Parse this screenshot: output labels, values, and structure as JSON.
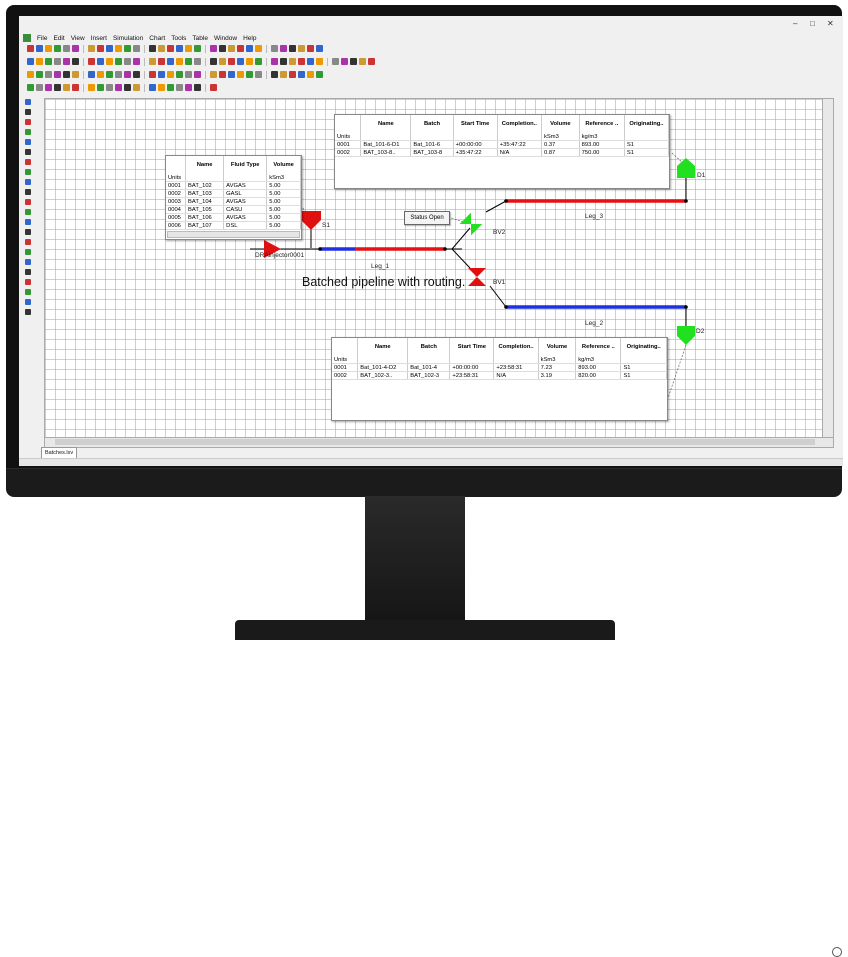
{
  "window": {
    "minimize_glyph": "–",
    "maximize_glyph": "□",
    "close_glyph": "✕"
  },
  "menu": [
    "File",
    "Edit",
    "View",
    "Insert",
    "Simulation",
    "Chart",
    "Tools",
    "Table",
    "Window",
    "Help"
  ],
  "tab": {
    "label": "Batches.lsv"
  },
  "caption": "Batched pipeline with routing.",
  "status_box": "Status Open",
  "labels": {
    "injector": "DRAinjector0001",
    "s1": "S1",
    "leg1": "Leg_1",
    "leg2": "Leg_2",
    "leg3": "Leg_3",
    "bv1": "BV1",
    "bv2": "BV2",
    "d1": "D1",
    "d2": "D2"
  },
  "colors": {
    "grid": "#78c878",
    "pipe_red": "#e81010",
    "pipe_blue": "#2030e0",
    "valve_red": "#e01010",
    "valve_green": "#20e020"
  },
  "batch_table": {
    "headers": [
      "",
      "Name",
      "Fluid Type",
      "Volume"
    ],
    "units": [
      "Units",
      "",
      "",
      "kSm3"
    ],
    "rows": [
      [
        "0001",
        "BAT_102",
        "AVGAS",
        "5.00"
      ],
      [
        "0002",
        "BAT_103",
        "GASL",
        "5.00"
      ],
      [
        "0003",
        "BAT_104",
        "AVGAS",
        "5.00"
      ],
      [
        "0004",
        "BAT_105",
        "CASU",
        "5.00"
      ],
      [
        "0005",
        "BAT_106",
        "AVGAS",
        "5.00"
      ],
      [
        "0006",
        "BAT_107",
        "DSL",
        "5.00"
      ]
    ]
  },
  "d1_table": {
    "headers": [
      "",
      "Name",
      "Batch",
      "Start Time",
      "Completion..",
      "Volume",
      "Reference ..",
      "Originating.."
    ],
    "units": [
      "Units",
      "",
      "",
      "",
      "",
      "kSm3",
      "kg/m3",
      ""
    ],
    "rows": [
      [
        "0001",
        "Bat_101-6-D1",
        "Bat_101-6",
        "+00:00:00",
        "+35:47:22",
        "0.37",
        "893.00",
        "S1"
      ],
      [
        "0002",
        "BAT_103-8..",
        "BAT_103-8",
        "+35:47:22",
        "N/A",
        "0.87",
        "750.00",
        "S1"
      ]
    ]
  },
  "d2_table": {
    "headers": [
      "",
      "Name",
      "Batch",
      "Start Time",
      "Completion..",
      "Volume",
      "Reference ..",
      "Originating.."
    ],
    "units": [
      "Units",
      "",
      "",
      "",
      "",
      "kSm3",
      "kg/m3",
      ""
    ],
    "rows": [
      [
        "0001",
        "Bat_101-4-D2",
        "Bat_101-4",
        "+00:00:00",
        "+23:58:31",
        "7.23",
        "893.00",
        "S1"
      ],
      [
        "0002",
        "BAT_102-3..",
        "BAT_102-3",
        "+23:58:31",
        "N/A",
        "3.19",
        "820.00",
        "S1"
      ]
    ]
  }
}
